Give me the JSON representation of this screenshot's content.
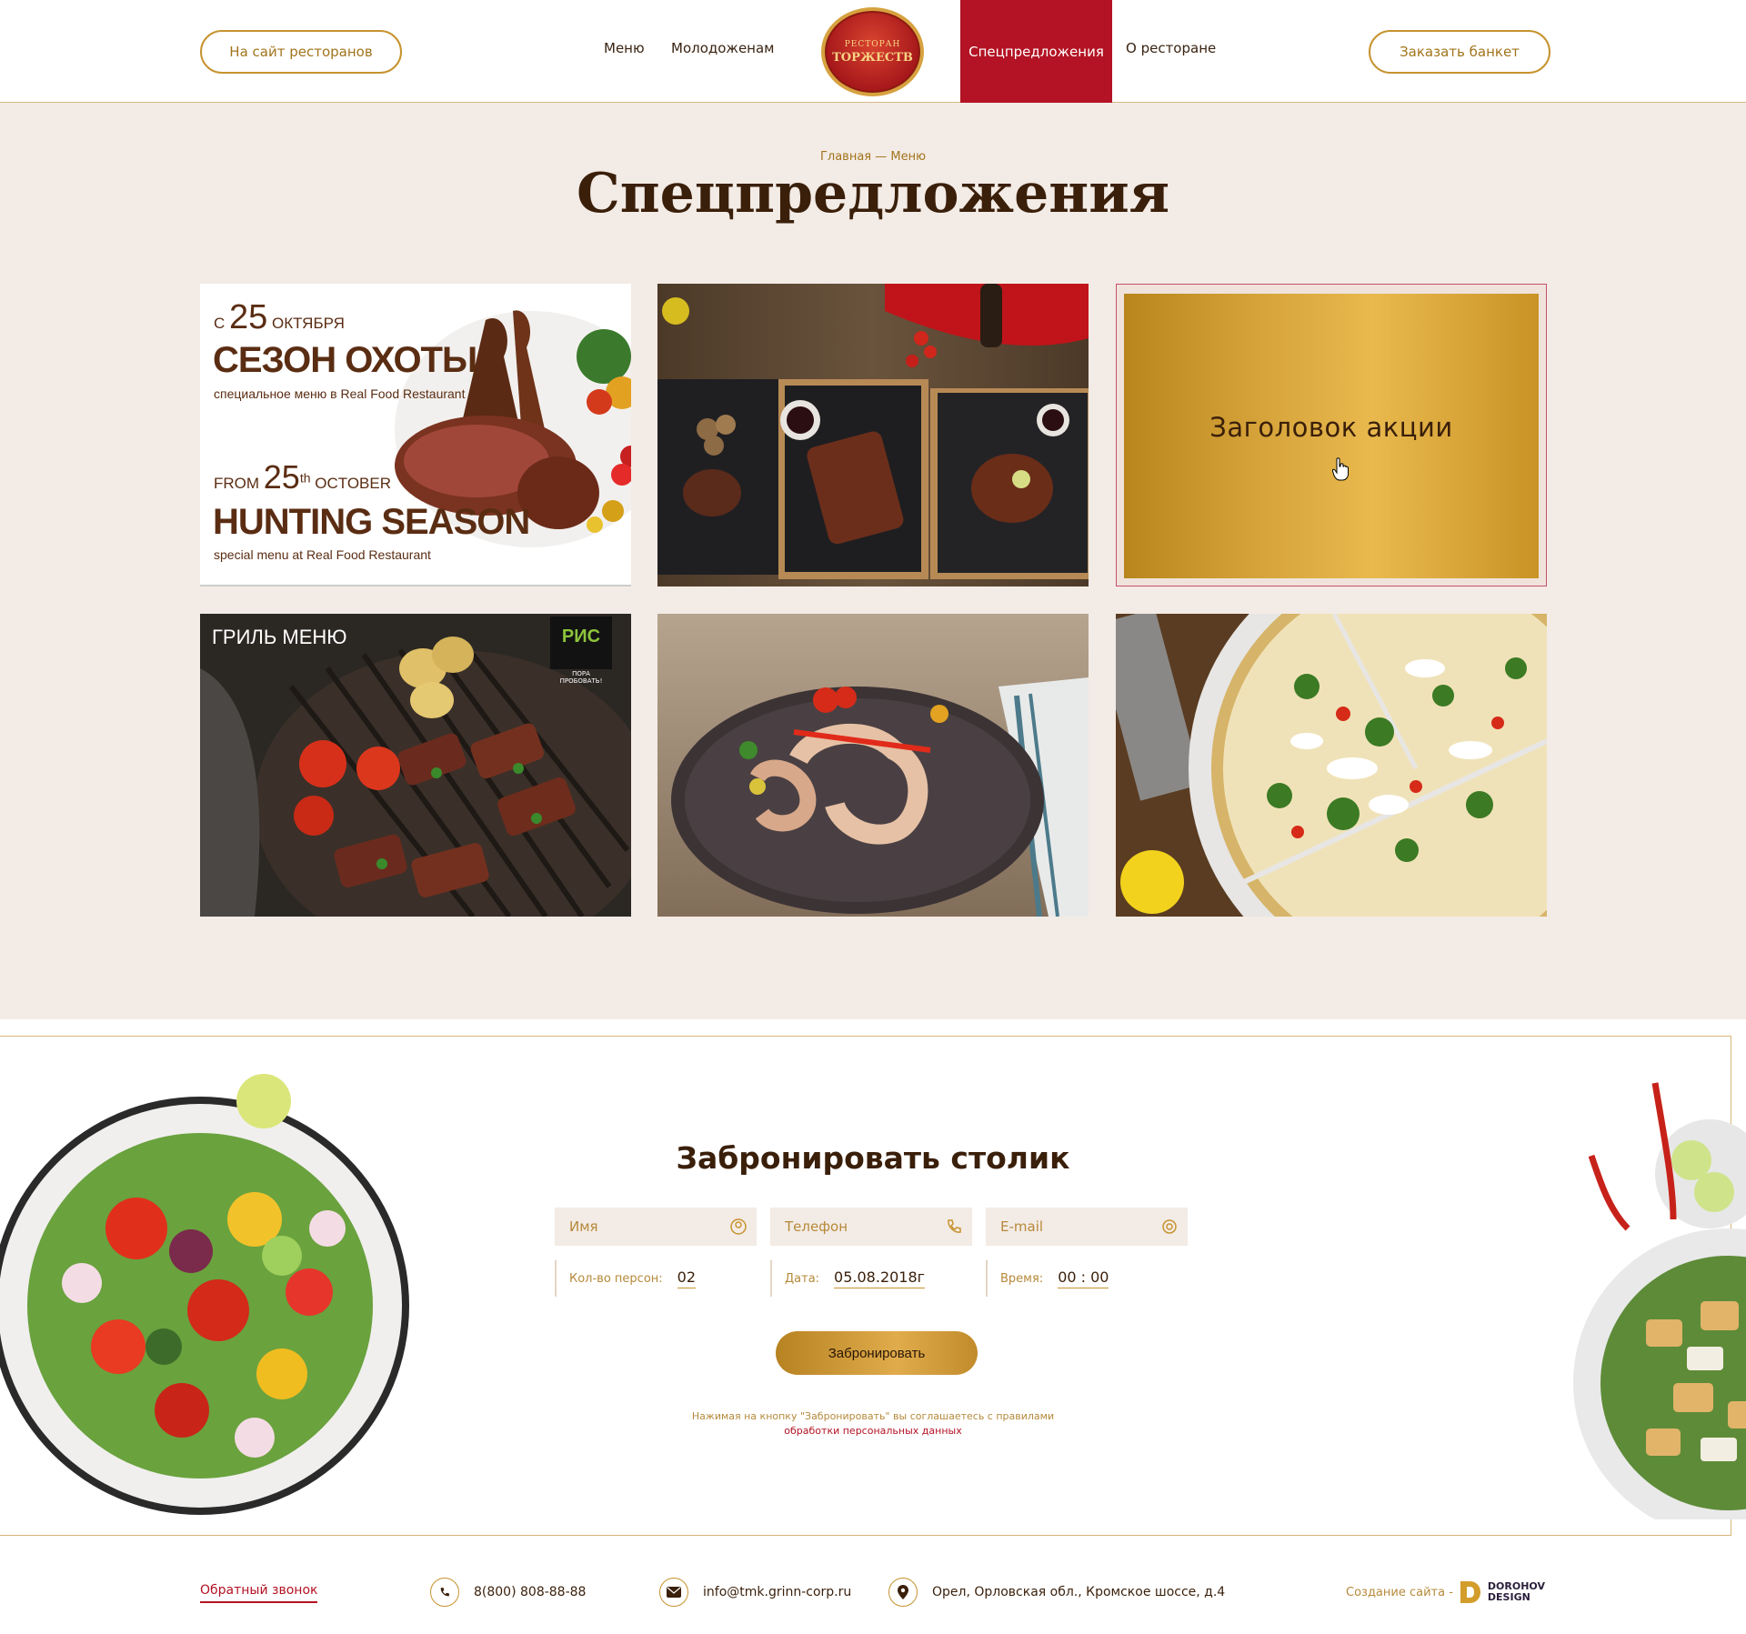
{
  "header": {
    "left_button": "На сайт ресторанов",
    "nav": [
      "Меню",
      "Молодоженам",
      "Спецпредложения",
      "О ресторане"
    ],
    "logo_line1": "РЕСТОРАН",
    "logo_line2": "ТОРЖЕСТВ",
    "right_button": "Заказать банкет"
  },
  "breadcrumb": "Главная — Меню",
  "page_title": "Спецпредложения",
  "promo": {
    "hunting": {
      "ru_from": "С",
      "ru_day": "25",
      "ru_month": "ОКТЯБРЯ",
      "ru_title": "СЕЗОН ОХОТЫ",
      "ru_sub": "специальное меню в Real Food Restaurant",
      "en_from": "FROM",
      "en_day": "25",
      "en_sup": "th",
      "en_month": "OCTOBER",
      "en_title": "HUNTING SEASON",
      "en_sub": "special menu at Real Food Restaurant"
    },
    "grill": {
      "title": "ГРИЛЬ МЕНЮ",
      "badge": "РИС",
      "badge_tag": "ПОРА ПРОБОВАТЬ!"
    },
    "hover_title": "Заголовок акции"
  },
  "booking": {
    "title": "Забронировать столик",
    "name_placeholder": "Имя",
    "phone_placeholder": "Телефон",
    "email_placeholder": "E-mail",
    "persons_label": "Кол-во персон:",
    "persons_value": "02",
    "date_label": "Дата:",
    "date_value": "05.08.2018г",
    "time_label": "Время:",
    "time_value": "00 : 00",
    "submit": "Забронировать",
    "consent_text": "Нажимая на кнопку \"Забронировать\" вы соглашаетесь с правилами",
    "consent_link": "обработки персональных данных"
  },
  "footer": {
    "callback": "Обратный звонок",
    "phone": "8(800) 808-88-88",
    "email": "info@tmk.grinn-corp.ru",
    "address": "Орел, Орловская обл., Кромское шоссе, д.4",
    "credit": "Создание сайта -",
    "credit_name_1": "DOROHOV",
    "credit_name_2": "DESIGN"
  },
  "colors": {
    "accent_red": "#b31324",
    "gold": "#c6932f",
    "bg": "#f3ebe5",
    "text_dark": "#3a1f0a"
  }
}
